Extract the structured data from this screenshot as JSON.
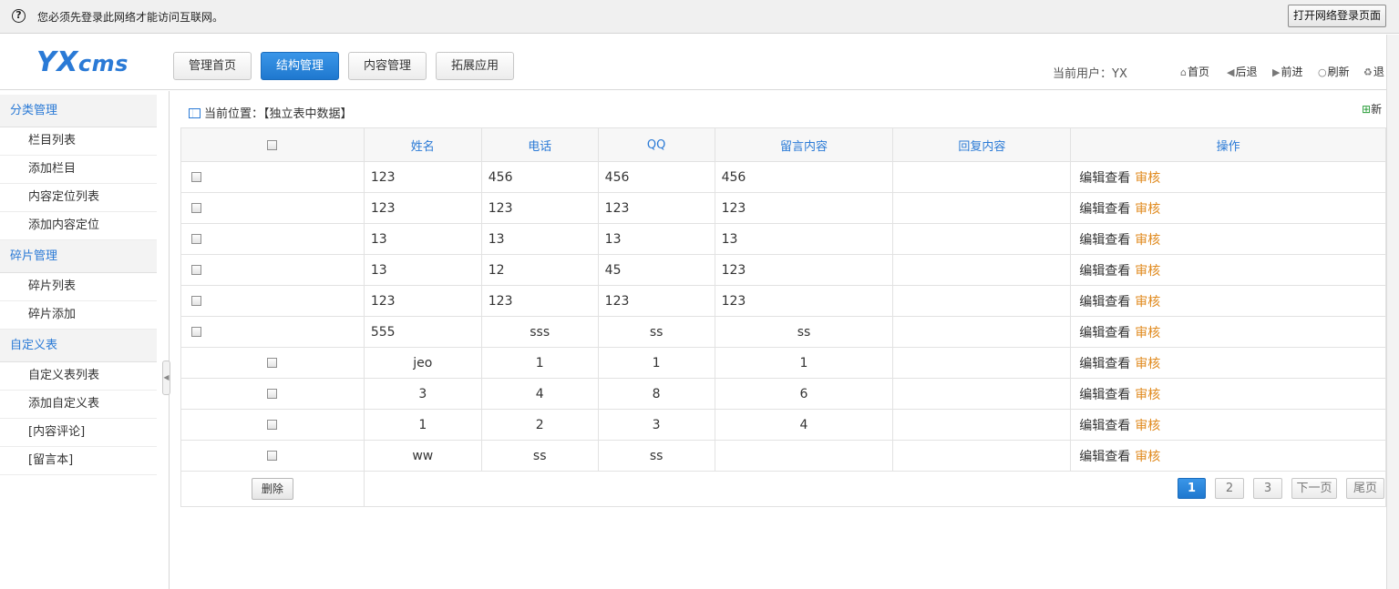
{
  "notification": {
    "message": "您必须先登录此网络才能访问互联网。",
    "open_login_button": "打开网络登录页面"
  },
  "header": {
    "logo_main": "YX",
    "logo_sub": "cms",
    "nav": [
      "管理首页",
      "结构管理",
      "内容管理",
      "拓展应用"
    ],
    "active_nav": "结构管理",
    "current_user": "当前用户：YX",
    "links": {
      "home": "首页",
      "back": "后退",
      "forward": "前进",
      "refresh": "刷新",
      "logout": "退"
    }
  },
  "sidebar": {
    "section_category": "分类管理",
    "category_items": [
      "栏目列表",
      "添加栏目",
      "内容定位列表",
      "添加内容定位"
    ],
    "section_fragment": "碎片管理",
    "fragment_items": [
      "碎片列表",
      "碎片添加"
    ],
    "section_custom": "自定义表",
    "custom_items": [
      "自定义表列表",
      "添加自定义表",
      "[内容评论]",
      "[留言本]"
    ]
  },
  "main": {
    "breadcrumb": "当前位置：【独立表中数据】",
    "new_link": "新",
    "columns": [
      "姓名",
      "电话",
      "QQ",
      "留言内容",
      "回复内容",
      "操作"
    ],
    "rows": [
      {
        "name": "123",
        "phone": "456",
        "qq": "456",
        "message": "456",
        "reply": "",
        "align": "left"
      },
      {
        "name": "123",
        "phone": "123",
        "qq": "123",
        "message": "123",
        "reply": "",
        "align": "left"
      },
      {
        "name": "13",
        "phone": "13",
        "qq": "13",
        "message": "13",
        "reply": "",
        "align": "left"
      },
      {
        "name": "13",
        "phone": "12",
        "qq": "45",
        "message": "123",
        "reply": "",
        "align": "left"
      },
      {
        "name": "123",
        "phone": "123",
        "qq": "123",
        "message": "123",
        "reply": "",
        "align": "left"
      },
      {
        "name": "555",
        "phone": "sss",
        "qq": "ss",
        "message": "ss",
        "reply": "",
        "align": "mixed"
      },
      {
        "name": "jeo",
        "phone": "1",
        "qq": "1",
        "message": "1",
        "reply": "",
        "align": "center"
      },
      {
        "name": "3",
        "phone": "4",
        "qq": "8",
        "message": "6",
        "reply": "",
        "align": "center"
      },
      {
        "name": "1",
        "phone": "2",
        "qq": "3",
        "message": "4",
        "reply": "",
        "align": "center"
      },
      {
        "name": "ww",
        "phone": "ss",
        "qq": "ss",
        "message": "",
        "reply": "",
        "align": "center"
      }
    ],
    "op_edit": "编辑查看",
    "op_audit": "审核",
    "delete_button": "删除",
    "pager": [
      "1",
      "2",
      "3",
      "下一页",
      "尾页"
    ],
    "current_page": "1"
  }
}
